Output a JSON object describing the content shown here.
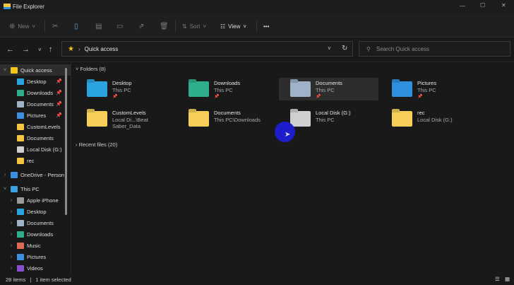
{
  "window": {
    "title": "File Explorer",
    "minimize": "—",
    "maximize": "☐",
    "close": "✕"
  },
  "toolbar": {
    "new": "New",
    "sort": "Sort",
    "view": "View",
    "more": "•••"
  },
  "address": {
    "path": "Quick access",
    "search_placeholder": "Search Quick access"
  },
  "sidebar": {
    "items": [
      {
        "label": "Quick access",
        "level": 0,
        "chev": "v",
        "color": "#f5c518",
        "pinned": false,
        "selected": true
      },
      {
        "label": "Desktop",
        "level": 1,
        "color": "#2aa3e0",
        "pinned": true
      },
      {
        "label": "Downloads",
        "level": 1,
        "color": "#2eae8a",
        "pinned": true
      },
      {
        "label": "Documents",
        "level": 1,
        "color": "#9fb2c8",
        "pinned": true
      },
      {
        "label": "Pictures",
        "level": 1,
        "color": "#3d8fe0",
        "pinned": true
      },
      {
        "label": "CustomLevels",
        "level": 1,
        "color": "#f5c542",
        "pinned": false
      },
      {
        "label": "Documents",
        "level": 1,
        "color": "#f5c542",
        "pinned": false
      },
      {
        "label": "Local Disk (G:)",
        "level": 1,
        "color": "#cfcfcf",
        "pinned": false
      },
      {
        "label": "rec",
        "level": 1,
        "color": "#f5c542",
        "pinned": false
      },
      {
        "label": "OneDrive - Person",
        "level": 0,
        "chev": ">",
        "color": "#3a8fe0",
        "pinned": false,
        "gap": true
      },
      {
        "label": "This PC",
        "level": 0,
        "chev": "v",
        "color": "#3aa0e0",
        "pinned": false,
        "gap": true
      },
      {
        "label": "Apple iPhone",
        "level": 1,
        "chev": ">",
        "color": "#9a9a9a"
      },
      {
        "label": "Desktop",
        "level": 1,
        "chev": ">",
        "color": "#2aa3e0"
      },
      {
        "label": "Documents",
        "level": 1,
        "chev": ">",
        "color": "#9fb2c8"
      },
      {
        "label": "Downloads",
        "level": 1,
        "chev": ">",
        "color": "#2eae8a"
      },
      {
        "label": "Music",
        "level": 1,
        "chev": ">",
        "color": "#e06a5a"
      },
      {
        "label": "Pictures",
        "level": 1,
        "chev": ">",
        "color": "#3d8fe0"
      },
      {
        "label": "Videos",
        "level": 1,
        "chev": ">",
        "color": "#8a4fd0"
      }
    ]
  },
  "main": {
    "folders_header": "Folders (8)",
    "recent_header": "Recent files (20)",
    "folders": [
      {
        "name": "Desktop",
        "location": "This PC",
        "pinned": true,
        "color": "#2aa3e0"
      },
      {
        "name": "Downloads",
        "location": "This PC",
        "pinned": true,
        "color": "#2eae8a"
      },
      {
        "name": "Documents",
        "location": "This PC",
        "pinned": true,
        "color": "#9fb2c8",
        "selected": true
      },
      {
        "name": "Pictures",
        "location": "This PC",
        "pinned": true,
        "color": "#2f8fe0"
      },
      {
        "name": "CustomLevels",
        "location": "Local Di...\\Beat Saber_Data",
        "color": "#f5cf5a"
      },
      {
        "name": "Documents",
        "location": "This PC\\Downloads",
        "color": "#f5cf5a"
      },
      {
        "name": "Local Disk (G:)",
        "location": "This PC",
        "color": "#cfcfcf"
      },
      {
        "name": "rec",
        "location": "Local Disk (G:)",
        "color": "#f5cf5a"
      }
    ]
  },
  "status": {
    "count": "28 items",
    "sep": "|",
    "selected": "1 item selected"
  }
}
